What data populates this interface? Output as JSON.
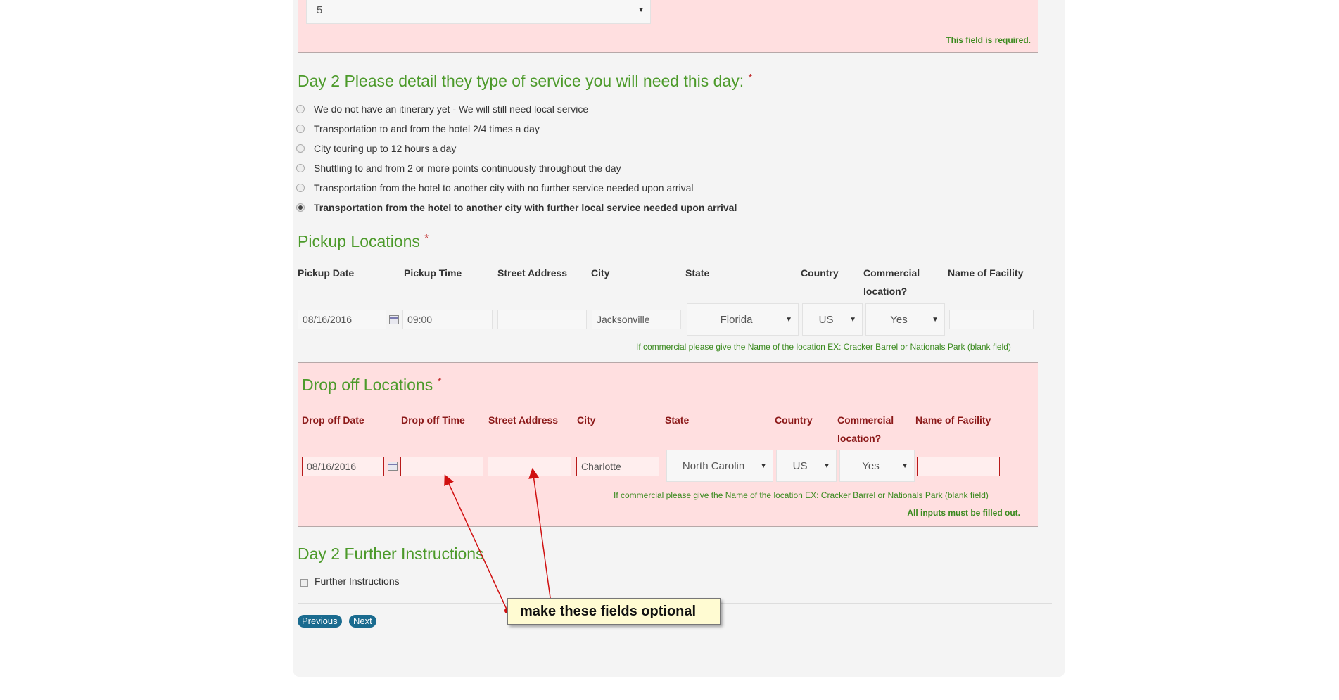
{
  "top_field": {
    "selected": "5",
    "error": "This field is required."
  },
  "day2_service": {
    "title": "Day 2 Please detail they type of service you will need this day:",
    "required_mark": "*",
    "options": [
      "We do not have an itinerary yet - We will still need local service",
      "Transportation to and from the hotel 2/4 times a day",
      "City touring up to 12 hours a day",
      "Shuttling to and from 2 or more points continuously throughout the day",
      "Transportation from the hotel to another city with no further service needed upon arrival",
      "Transportation from the hotel to another city with further local service needed upon arrival"
    ],
    "selected_index": 5
  },
  "pickup": {
    "title": "Pickup Locations",
    "required_mark": "*",
    "headers": [
      "Pickup Date",
      "Pickup Time",
      "Street Address",
      "City",
      "State",
      "Country",
      "Commercial location?",
      "Name of Facility"
    ],
    "date": "08/16/2016",
    "time": "09:00",
    "street": "",
    "city": "Jacksonville",
    "state": "Florida",
    "country": "US",
    "commercial": "Yes",
    "facility": "",
    "note": "If commercial please give the Name of the location EX: Cracker Barrel or Nationals Park (blank field)"
  },
  "dropoff": {
    "title": "Drop off Locations",
    "required_mark": "*",
    "headers": [
      "Drop off Date",
      "Drop off Time",
      "Street Address",
      "City",
      "State",
      "Country",
      "Commercial location?",
      "Name of Facility"
    ],
    "date": "08/16/2016",
    "time": "",
    "street": "",
    "city": "Charlotte",
    "state": "North Carolin",
    "country": "US",
    "commercial": "Yes",
    "facility": "",
    "note": "If commercial please give the Name of the location EX: Cracker Barrel or Nationals Park (blank field)",
    "error": "All inputs must be filled out."
  },
  "further": {
    "title": "Day 2 Further Instructions",
    "checkbox_label": "Further Instructions"
  },
  "nav": {
    "previous": "Previous",
    "next": "Next"
  },
  "annotation": {
    "text": "make these fields optional",
    "color": "#d01010"
  },
  "colors": {
    "heading_green": "#4c9a2a",
    "error_bg": "#ffdfe0",
    "button_blue": "#1a6b8f"
  }
}
